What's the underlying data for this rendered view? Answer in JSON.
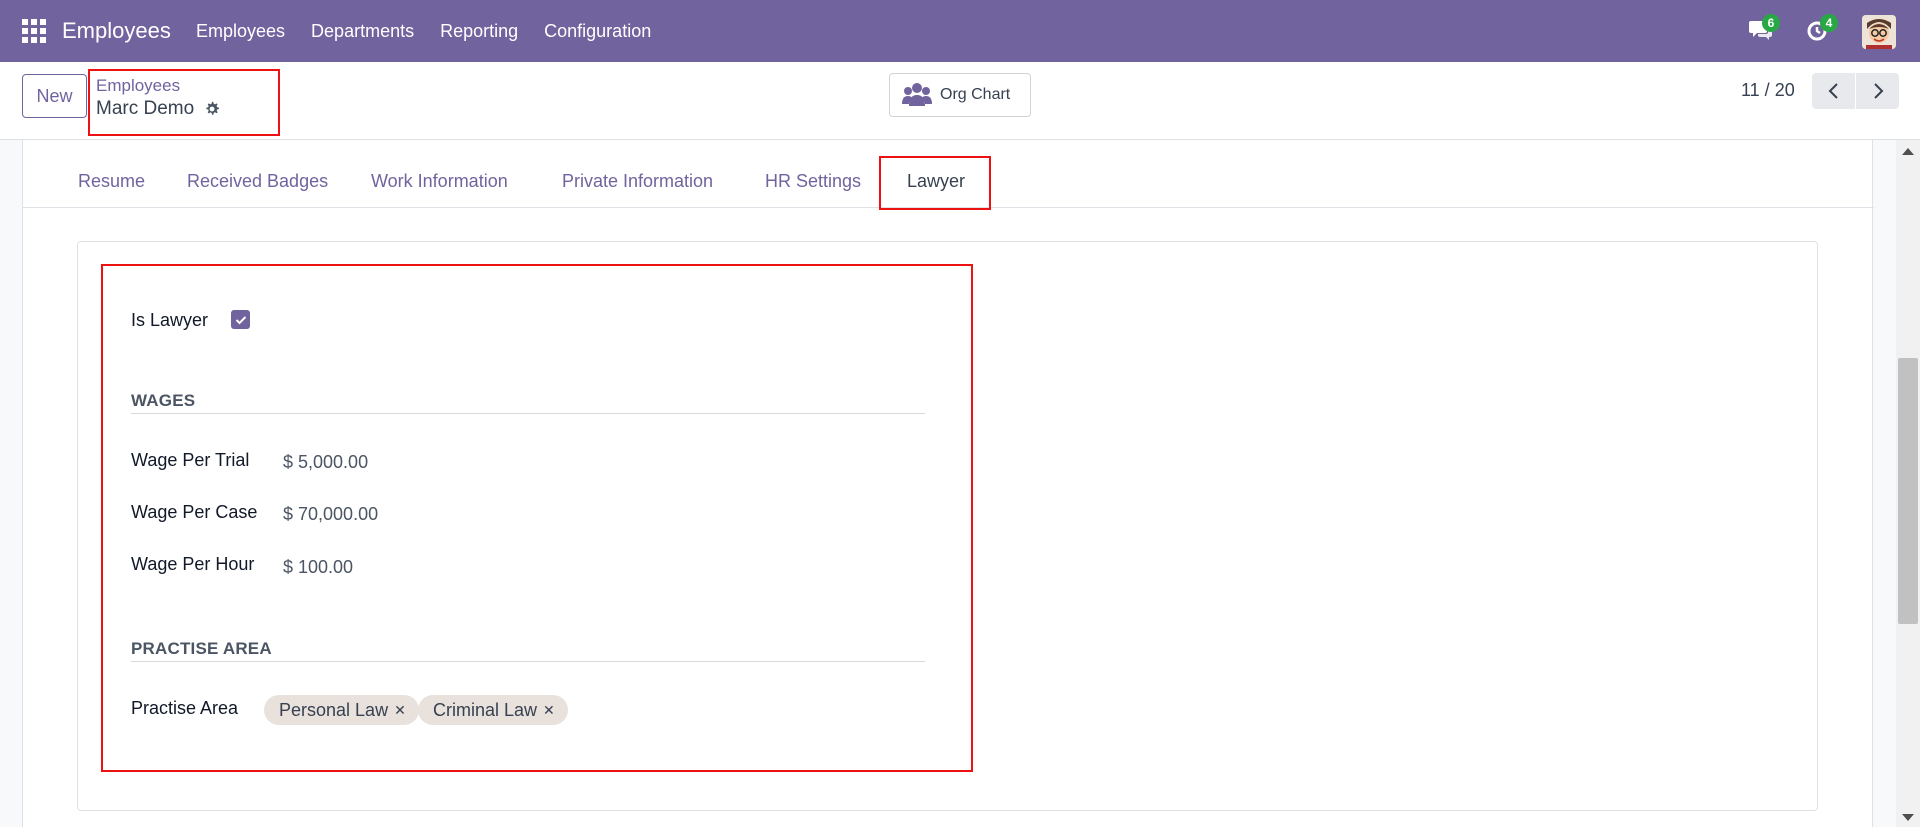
{
  "navbar": {
    "brand": "Employees",
    "menu": [
      "Employees",
      "Departments",
      "Reporting",
      "Configuration"
    ],
    "chat_count": "6",
    "activity_count": "4"
  },
  "control_panel": {
    "new_label": "New",
    "breadcrumb_parent": "Employees",
    "breadcrumb_current": "Marc Demo",
    "org_chart_label": "Org Chart",
    "pager": "11 / 20"
  },
  "tabs": [
    "Resume",
    "Received Badges",
    "Work Information",
    "Private Information",
    "HR Settings",
    "Lawyer"
  ],
  "active_tab": "Lawyer",
  "lawyer": {
    "is_lawyer_label": "Is Lawyer",
    "is_lawyer_checked": true,
    "wages_title": "WAGES",
    "wages": [
      {
        "label": "Wage Per Trial",
        "value": "$ 5,000.00"
      },
      {
        "label": "Wage Per Case",
        "value": "$ 70,000.00"
      },
      {
        "label": "Wage Per Hour",
        "value": "$ 100.00"
      }
    ],
    "practise_title": "PRACTISE AREA",
    "practise_label": "Practise Area",
    "practise_tags": [
      "Personal Law",
      "Criminal Law"
    ]
  },
  "colors": {
    "brand": "#71639e",
    "highlight": "#ee1111",
    "tag_bg": "#e9e1dc",
    "badge": "#28a745"
  }
}
